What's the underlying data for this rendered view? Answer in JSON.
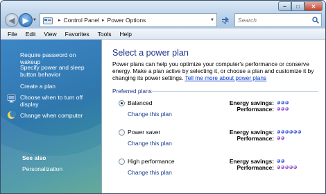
{
  "window": {
    "breadcrumb": [
      "Control Panel",
      "Power Options"
    ],
    "search_placeholder": "Search",
    "controls": {
      "minimize": "–",
      "maximize": "□",
      "close": "✕"
    }
  },
  "menu": [
    "File",
    "Edit",
    "View",
    "Favorites",
    "Tools",
    "Help"
  ],
  "sidebar": {
    "links": [
      {
        "label": "Require password on wakeup",
        "icon": ""
      },
      {
        "label": "Specify power and sleep button behavior",
        "icon": ""
      },
      {
        "label": "Create a plan",
        "icon": ""
      },
      {
        "label": "Choose when to turn off display",
        "icon": "monitor-icon"
      },
      {
        "label": "Change when computer",
        "icon": "moon-icon"
      }
    ],
    "see_also_heading": "See also",
    "see_also_links": [
      "Personalization"
    ]
  },
  "main": {
    "title": "Select a power plan",
    "description": "Power plans can help you optimize your computer's performance or conserve energy. Make a plan active by selecting it, or choose a plan and customize it by changing its power settings.",
    "learn_more_link": "Tell me more about power plans",
    "group_label": "Preferred plans",
    "energy_label": "Energy savings:",
    "performance_label": "Performance:",
    "plans": [
      {
        "name": "Balanced",
        "change_label": "Change this plan",
        "selected": true,
        "energy_savings": 3,
        "performance": 3
      },
      {
        "name": "Power saver",
        "change_label": "Change this plan",
        "selected": false,
        "energy_savings": 6,
        "performance": 2
      },
      {
        "name": "High performance",
        "change_label": "Change this plan",
        "selected": false,
        "energy_savings": 2,
        "performance": 5
      }
    ]
  },
  "colors": {
    "energy_dot": "#2e4fd6",
    "performance_dot": "#8a3fc9",
    "title_blue": "#1e3287",
    "link_blue": "#0033cc"
  }
}
